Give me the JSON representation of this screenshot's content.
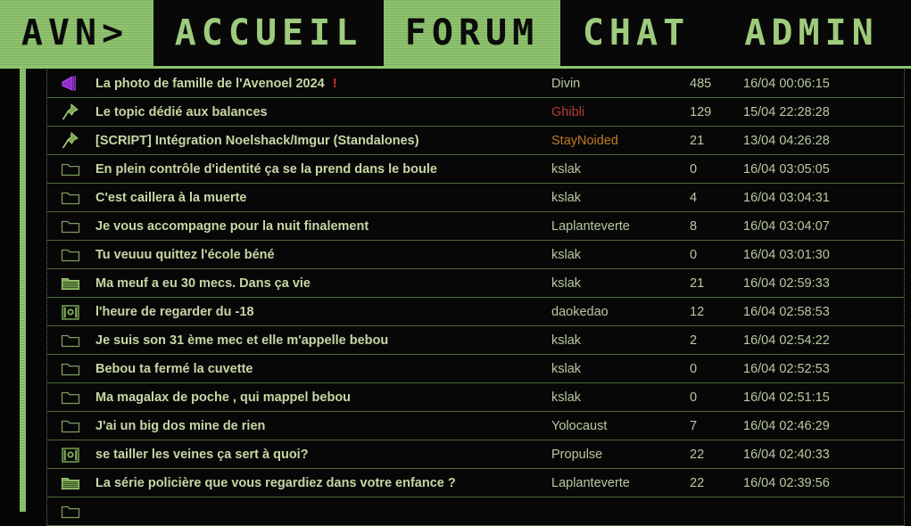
{
  "site": {
    "logo": "AVN>",
    "accent_green": "#8fc46e",
    "text_green": "#c6d7a5",
    "background": "#050505"
  },
  "nav": {
    "items": [
      {
        "label": "ACCUEIL",
        "active": false
      },
      {
        "label": "FORUM",
        "active": true
      },
      {
        "label": "CHAT",
        "active": false
      },
      {
        "label": "ADMIN",
        "active": false
      }
    ]
  },
  "forum": {
    "rows": [
      {
        "icon": "megaphone-icon",
        "title": "La photo de famille de l'Avenoel 2024",
        "flag": "!",
        "author": "Divin",
        "author_color": "normal",
        "count": "485",
        "date": "16/04 00:06:15"
      },
      {
        "icon": "pin-icon",
        "title": "Le topic dédié aux balances",
        "flag": "",
        "author": "Ghibli",
        "author_color": "red",
        "count": "129",
        "date": "15/04 22:28:28"
      },
      {
        "icon": "pin-icon",
        "title": "[SCRIPT] Intégration Noelshack/Imgur (Standalones)",
        "flag": "",
        "author": "StayNoided",
        "author_color": "orange",
        "count": "21",
        "date": "13/04 04:26:28"
      },
      {
        "icon": "folder-empty-icon",
        "title": "En plein contrôle d'identité ça se la prend dans le boule",
        "flag": "",
        "author": "kslak",
        "author_color": "normal",
        "count": "0",
        "date": "16/04 03:05:05"
      },
      {
        "icon": "folder-empty-icon",
        "title": "C'est caillera à la muerte",
        "flag": "",
        "author": "kslak",
        "author_color": "normal",
        "count": "4",
        "date": "16/04 03:04:31"
      },
      {
        "icon": "folder-empty-icon",
        "title": "Je vous accompagne pour la nuit finalement",
        "flag": "",
        "author": "Laplanteverte",
        "author_color": "normal",
        "count": "8",
        "date": "16/04 03:04:07"
      },
      {
        "icon": "folder-empty-icon",
        "title": "Tu veuuu quittez l'école béné",
        "flag": "",
        "author": "kslak",
        "author_color": "normal",
        "count": "0",
        "date": "16/04 03:01:30"
      },
      {
        "icon": "folder-full-icon",
        "title": "Ma meuf a eu 30 mecs. Dans ça vie",
        "flag": "",
        "author": "kslak",
        "author_color": "normal",
        "count": "21",
        "date": "16/04 02:59:33"
      },
      {
        "icon": "folder-locked-icon",
        "title": "l'heure de regarder du -18",
        "flag": "",
        "author": "daokedao",
        "author_color": "normal",
        "count": "12",
        "date": "16/04 02:58:53"
      },
      {
        "icon": "folder-empty-icon",
        "title": "Je suis son 31 ème mec et elle m'appelle bebou",
        "flag": "",
        "author": "kslak",
        "author_color": "normal",
        "count": "2",
        "date": "16/04 02:54:22"
      },
      {
        "icon": "folder-empty-icon",
        "title": "Bebou ta fermé la cuvette",
        "flag": "",
        "author": "kslak",
        "author_color": "normal",
        "count": "0",
        "date": "16/04 02:52:53"
      },
      {
        "icon": "folder-empty-icon",
        "title": "Ma magalax de poche , qui mappel bebou",
        "flag": "",
        "author": "kslak",
        "author_color": "normal",
        "count": "0",
        "date": "16/04 02:51:15"
      },
      {
        "icon": "folder-empty-icon",
        "title": "J'ai un big dos mine de rien",
        "flag": "",
        "author": "Yolocaust",
        "author_color": "normal",
        "count": "7",
        "date": "16/04 02:46:29"
      },
      {
        "icon": "folder-locked-icon",
        "title": "se tailler les veines ça sert à quoi?",
        "flag": "",
        "author": "Propulse",
        "author_color": "normal",
        "count": "22",
        "date": "16/04 02:40:33"
      },
      {
        "icon": "folder-full-icon",
        "title": "La série policière que vous regardiez dans votre enfance ?",
        "flag": "",
        "author": "Laplanteverte",
        "author_color": "normal",
        "count": "22",
        "date": "16/04 02:39:56"
      },
      {
        "icon": "folder-empty-icon",
        "title": "",
        "flag": "",
        "author": "",
        "author_color": "normal",
        "count": "",
        "date": ""
      }
    ]
  }
}
